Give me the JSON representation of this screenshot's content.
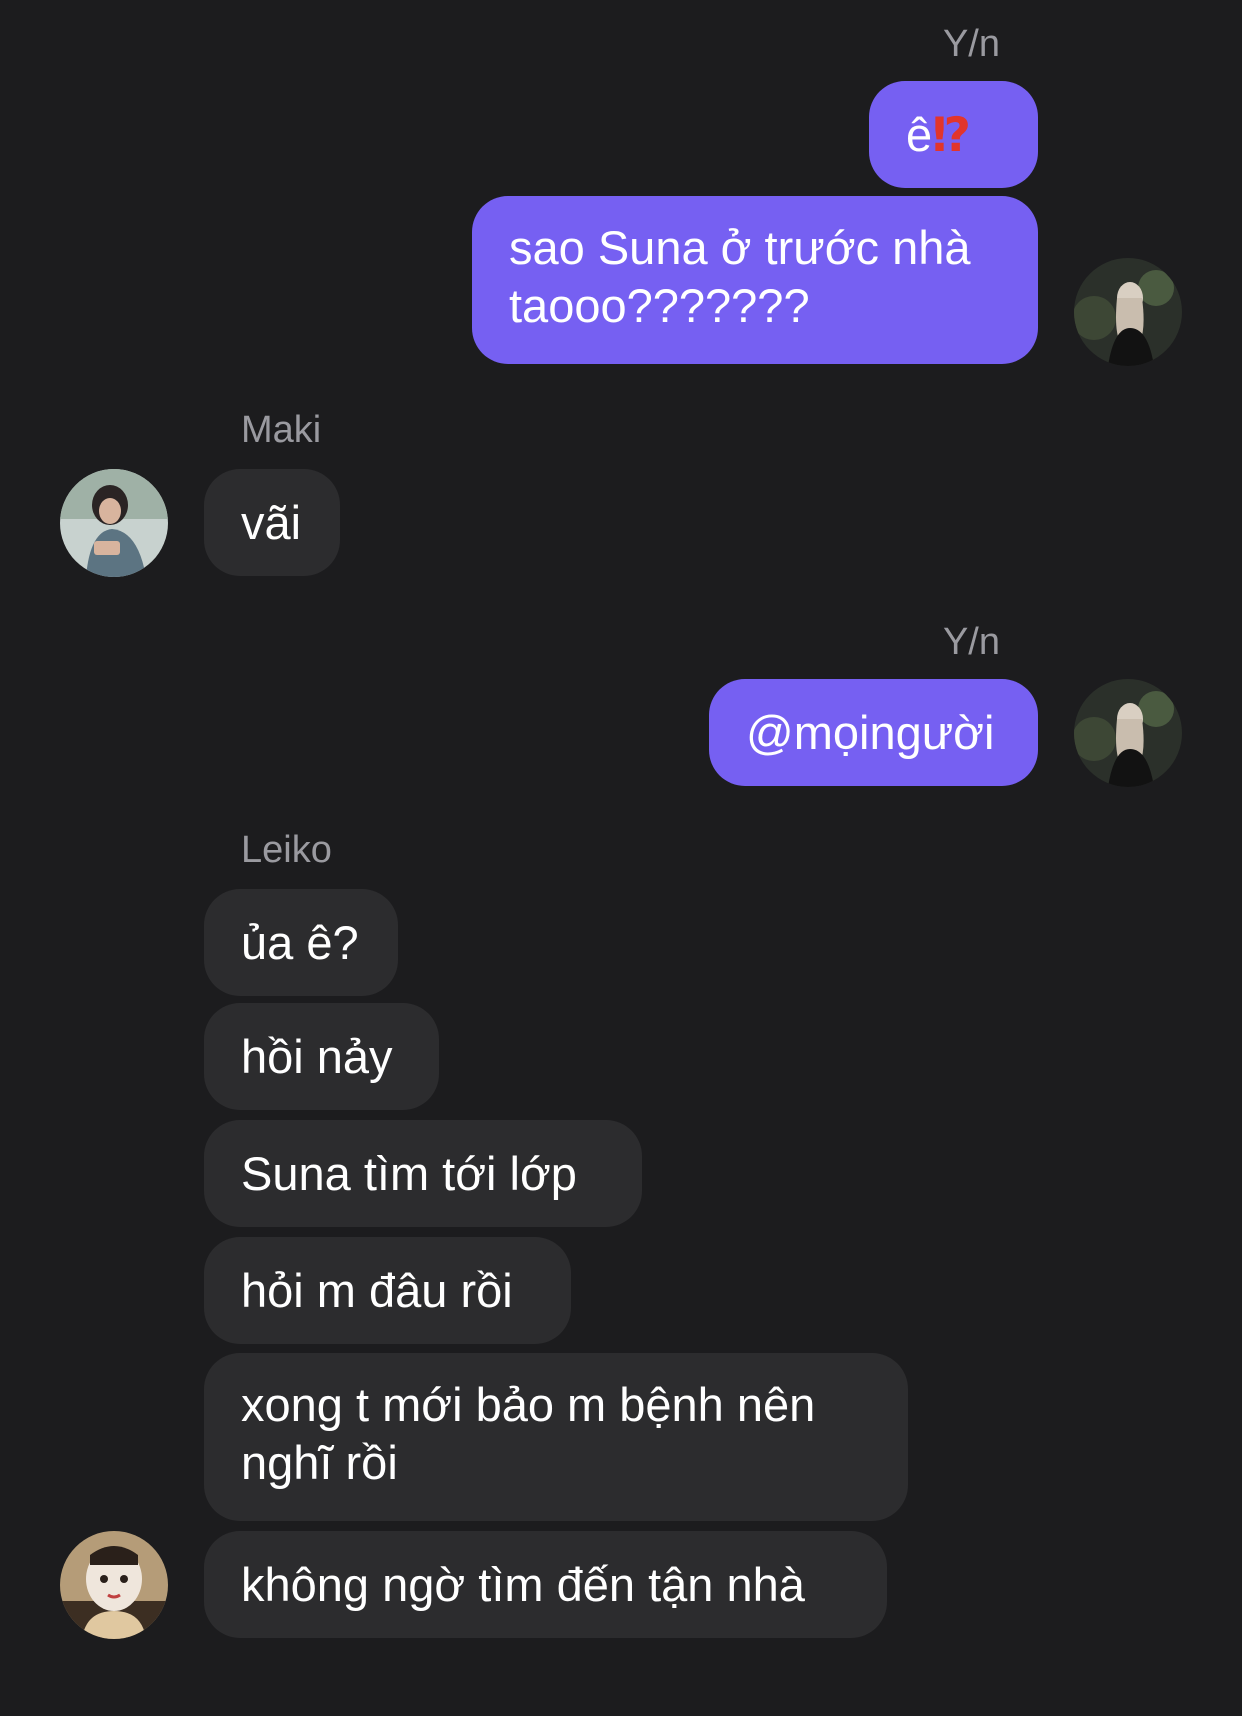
{
  "messages": {
    "yn_1_name": "Y/n",
    "yn_1_msg1": "ê⁉",
    "yn_1_msg2": "sao Suna ở trước nhà taooo???????",
    "maki_name": "Maki",
    "maki_msg1": "vãi",
    "yn_2_name": "Y/n",
    "yn_2_msg1": "@mọingười",
    "leiko_name": "Leiko",
    "leiko_msgs": [
      "ủa ê?",
      "hồi nảy",
      "Suna tìm tới lớp",
      "hỏi m đâu rồi",
      "xong t mới bảo m bệnh nên nghĩ rồi",
      "không ngờ tìm đến tận nhà"
    ]
  },
  "colors": {
    "background": "#1c1c1e",
    "outgoing_bubble": "#7660f2",
    "incoming_bubble": "#2c2c2e",
    "sender_name": "#9a9aa0",
    "emoji_red": "#e2352b"
  },
  "avatars": {
    "yn": "avatar-yn",
    "maki": "avatar-maki",
    "leiko": "avatar-leiko"
  }
}
